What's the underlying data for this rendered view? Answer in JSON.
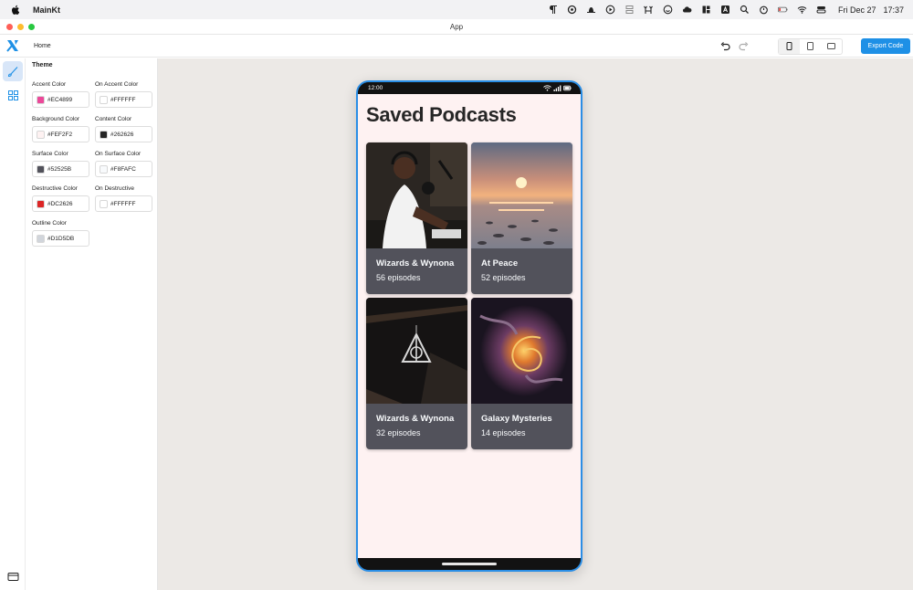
{
  "menubar": {
    "app_name": "MainKt",
    "date": "Fri Dec 27",
    "time": "17:37"
  },
  "window": {
    "title": "App"
  },
  "toolbar": {
    "breadcrumb": "Home",
    "export_label": "Export Code"
  },
  "theme": {
    "title": "Theme",
    "fields": [
      {
        "label": "Accent Color",
        "value": "#EC4899",
        "color": "#EC4899"
      },
      {
        "label": "On Accent Color",
        "value": "#FFFFFF",
        "color": "#FFFFFF"
      },
      {
        "label": "Background Color",
        "value": "#FEF2F2",
        "color": "#FEF2F2"
      },
      {
        "label": "Content Color",
        "value": "#262626",
        "color": "#262626"
      },
      {
        "label": "Surface Color",
        "value": "#52525B",
        "color": "#52525B"
      },
      {
        "label": "On Surface Color",
        "value": "#F8FAFC",
        "color": "#F8FAFC"
      },
      {
        "label": "Destructive Color",
        "value": "#DC2626",
        "color": "#DC2626"
      },
      {
        "label": "On Destructive",
        "value": "#FFFFFF",
        "color": "#FFFFFF"
      },
      {
        "label": "Outline Color",
        "value": "#D1D5DB",
        "color": "#D1D5DB"
      }
    ]
  },
  "phone": {
    "time": "12:00",
    "heading": "Saved Podcasts",
    "podcasts": [
      {
        "name": "Wizards & Wynona",
        "episodes": "56 episodes"
      },
      {
        "name": "At Peace",
        "episodes": "52 episodes"
      },
      {
        "name": "Wizards & Wynona",
        "episodes": "32 episodes"
      },
      {
        "name": "Galaxy Mysteries",
        "episodes": "14 episodes"
      }
    ]
  }
}
